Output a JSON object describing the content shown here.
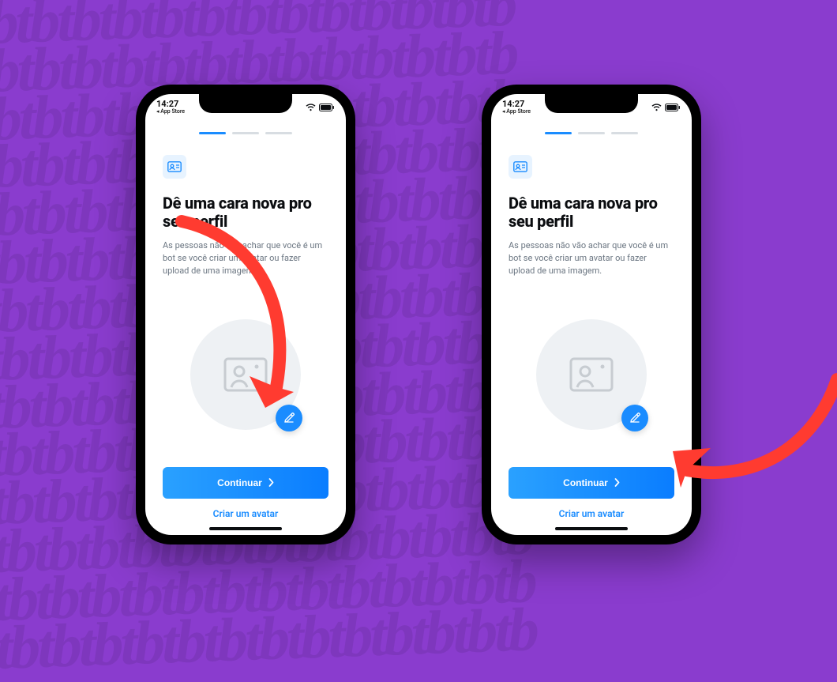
{
  "status_bar": {
    "time": "14:27",
    "back_label": "◂ App Store"
  },
  "progress": {
    "total": 3,
    "current": 1
  },
  "screen": {
    "heading": "Dê uma cara nova pro seu perfil",
    "subtext": "As pessoas não vão achar que você é um bot se você criar um avatar ou fazer upload de uma imagem.",
    "primary_button": "Continuar",
    "secondary_link": "Criar um avatar"
  },
  "icons": {
    "badge": "id-card-icon",
    "avatar_placeholder": "user-photo-placeholder-icon",
    "edit": "pencil-icon",
    "chevron": "chevron-right-icon",
    "wifi": "wifi-icon",
    "battery": "battery-icon"
  },
  "colors": {
    "accent": "#1a8cff",
    "bg": "#8a3cce",
    "annotation": "#ff3b30"
  }
}
